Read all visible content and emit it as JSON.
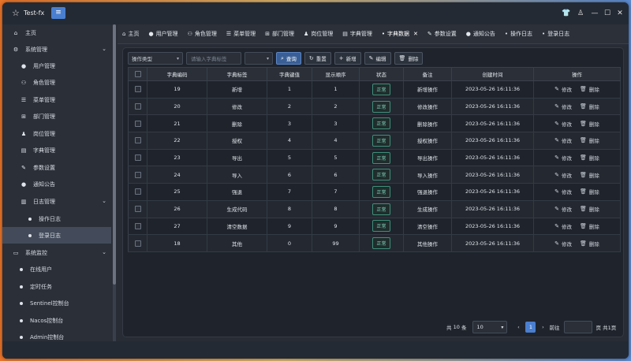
{
  "window": {
    "title": "Test-fx"
  },
  "sidebar": {
    "items": [
      {
        "label": "主页",
        "icon": "home-icon"
      },
      {
        "label": "系统管理",
        "icon": "gear-icon"
      },
      {
        "label": "用户管理",
        "icon": "user-icon"
      },
      {
        "label": "角色管理",
        "icon": "users-icon"
      },
      {
        "label": "菜单管理",
        "icon": "menu-icon"
      },
      {
        "label": "部门管理",
        "icon": "sitemap-icon"
      },
      {
        "label": "岗位管理",
        "icon": "user-tie-icon"
      },
      {
        "label": "字典管理",
        "icon": "book-icon"
      },
      {
        "label": "参数设置",
        "icon": "edit-icon"
      },
      {
        "label": "通知公告",
        "icon": "chat-icon"
      },
      {
        "label": "日志管理",
        "icon": "log-icon"
      },
      {
        "label": "操作日志"
      },
      {
        "label": "登录日志"
      },
      {
        "label": "系统监控",
        "icon": "monitor-icon"
      },
      {
        "label": "在线用户"
      },
      {
        "label": "定时任务"
      },
      {
        "label": "Sentinel控制台"
      },
      {
        "label": "Nacos控制台"
      },
      {
        "label": "Admin控制台"
      }
    ]
  },
  "tabs": [
    {
      "label": "主页"
    },
    {
      "label": "用户管理"
    },
    {
      "label": "角色管理"
    },
    {
      "label": "菜单管理"
    },
    {
      "label": "部门管理"
    },
    {
      "label": "岗位管理"
    },
    {
      "label": "字典管理"
    },
    {
      "label": "字典数据"
    },
    {
      "label": "参数设置"
    },
    {
      "label": "通知公告"
    },
    {
      "label": "操作日志"
    },
    {
      "label": "登录日志"
    }
  ],
  "toolbar": {
    "type_select": "操作类型",
    "label_placeholder": "请输入字典标签",
    "query": "查询",
    "reset": "重置",
    "add": "新增",
    "edit": "编辑",
    "delete": "删除"
  },
  "table": {
    "headers": [
      "字典编码",
      "字典标签",
      "字典键值",
      "显示顺序",
      "状态",
      "备注",
      "创建时间",
      "操作"
    ],
    "rows": [
      [
        "19",
        "新增",
        "1",
        "1",
        "正常",
        "新增操作",
        "2023-05-26 16:11:36"
      ],
      [
        "20",
        "修改",
        "2",
        "2",
        "正常",
        "修改操作",
        "2023-05-26 16:11:36"
      ],
      [
        "21",
        "删除",
        "3",
        "3",
        "正常",
        "删除操作",
        "2023-05-26 16:11:36"
      ],
      [
        "22",
        "授权",
        "4",
        "4",
        "正常",
        "授权操作",
        "2023-05-26 16:11:36"
      ],
      [
        "23",
        "导出",
        "5",
        "5",
        "正常",
        "导出操作",
        "2023-05-26 16:11:36"
      ],
      [
        "24",
        "导入",
        "6",
        "6",
        "正常",
        "导入操作",
        "2023-05-26 16:11:36"
      ],
      [
        "25",
        "强退",
        "7",
        "7",
        "正常",
        "强退操作",
        "2023-05-26 16:11:36"
      ],
      [
        "26",
        "生成代码",
        "8",
        "8",
        "正常",
        "生成操作",
        "2023-05-26 16:11:36"
      ],
      [
        "27",
        "清空数据",
        "9",
        "9",
        "正常",
        "清空操作",
        "2023-05-26 16:11:36"
      ],
      [
        "18",
        "其他",
        "0",
        "99",
        "正常",
        "其他操作",
        "2023-05-26 16:11:36"
      ]
    ],
    "edit_label": "修改",
    "delete_label": "删除"
  },
  "pager": {
    "total_prefix": "共",
    "total": "10",
    "total_suffix": "条",
    "page_size": "10",
    "current_page": "1",
    "goto_label": "前往",
    "pages_suffix": "页 共1页"
  }
}
